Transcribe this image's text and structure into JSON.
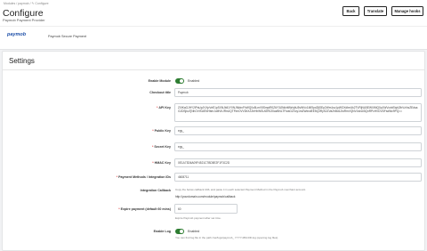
{
  "header": {
    "breadcrumb": "Modules  /  paymob  /  ✎ Configure",
    "title": "Configure",
    "subtitle": "Paymob Payment Provider",
    "buttons": {
      "back": "Back",
      "translate": "Translate",
      "manage_hooks": "Manage hooks"
    }
  },
  "module": {
    "logo": "paymob",
    "name": "Paymob Secure Payment"
  },
  "settings": {
    "title": "Settings",
    "enable_module": {
      "label": "Enable Module",
      "state": "Enabled"
    },
    "checkout_title": {
      "label": "Checkout title",
      "value": "Paymob"
    },
    "api_key": {
      "label": "API Key",
      "value": "ZXlKaGJHY2lPaUpJVXpVeE1pSXNJblI1Y0NJNklrcFhWQ0o5LmV5SmpiR0Z6Y3lJNklrMWxjbU5vWVc1MElpd2ljSEp2Wm1sc1pWOXdheUk2TVRjNU5EWXlMQ0p1WVcxbElqb2lhVzVwZEdsaGJDSjkuTjNhOVlSUENHbmJuMVhJRmJQTFlmOVV2bXZZeHhWSUt2R0Z0azBNLTFwaGZXcy1mZWdxdEE5Q3RyS2ZVa2hBd1ZwRmVQNVJsbUl3QnRPcHVDVDFsdWc9PQ=="
    },
    "public_key": {
      "label": "Public Key",
      "value": "egy_"
    },
    "secret_key": {
      "label": "Secret Key",
      "value": "egy_"
    },
    "hmac_key": {
      "label": "HMAC Key",
      "value": "0E1A73D6A09F4521C7BD5E2F1F3C2D"
    },
    "payment_methods": {
      "label": "Payment Methods / Integration IDs",
      "value": "4608711"
    },
    "integration_callback": {
      "label": "Integration Callback",
      "help": "Copy the below callback URL and paste it in each selected Payment Method in the Paymob merchant account.",
      "url": "http://yourdomain.com/module/paymob/callback"
    },
    "expire_payment": {
      "label": "Expire payment (default 60 mins)",
      "value": "60",
      "help": "Expire Paymob payment after set time."
    },
    "enable_log": {
      "label": "Enable Log",
      "state": "Enabled",
      "help": "You can find log file in the path /var/logs/paymob_ YYYY-MM-DD.log (opening log files)."
    }
  }
}
